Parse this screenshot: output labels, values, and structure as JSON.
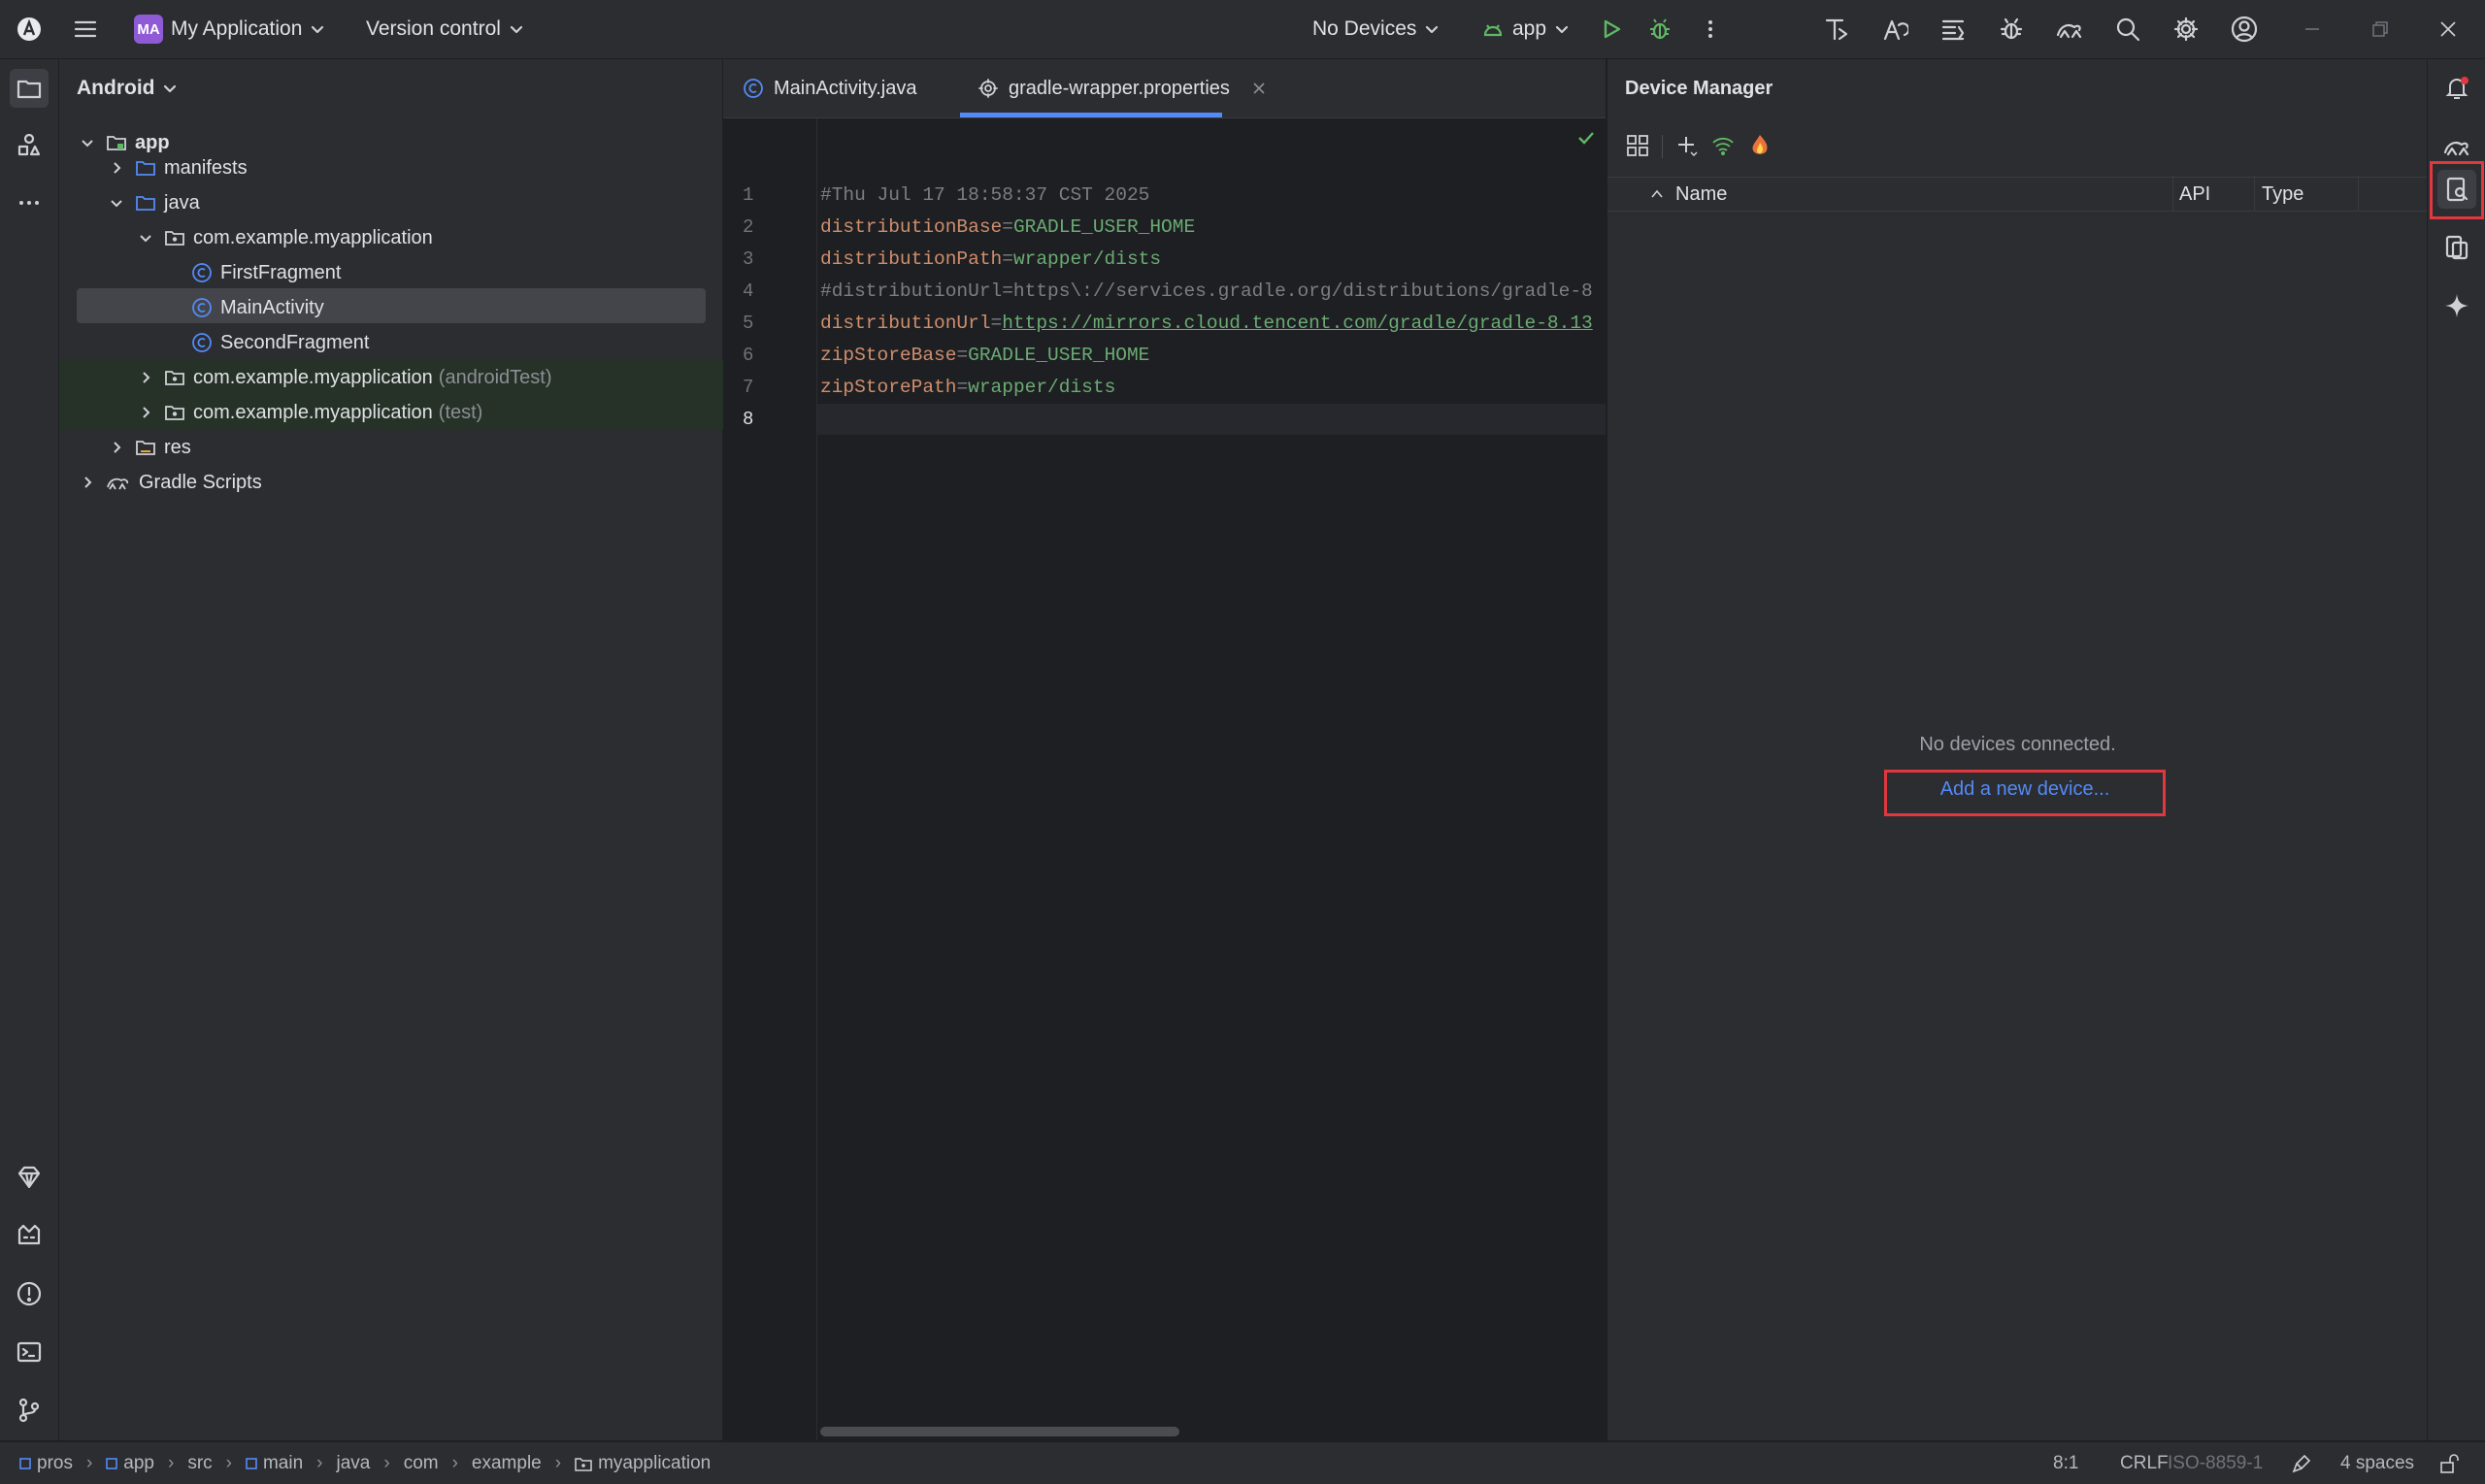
{
  "titlebar": {
    "project_badge": "MA",
    "project_name": "My Application",
    "vcs": "Version control",
    "devices": "No Devices",
    "run_config": "app"
  },
  "project_panel": {
    "view_mode": "Android",
    "tree": [
      {
        "label": "app",
        "suffix": ""
      },
      {
        "label": "manifests",
        "suffix": ""
      },
      {
        "label": "java",
        "suffix": ""
      },
      {
        "label": "com.example.myapplication",
        "suffix": ""
      },
      {
        "label": "FirstFragment",
        "suffix": ""
      },
      {
        "label": "MainActivity",
        "suffix": ""
      },
      {
        "label": "SecondFragment",
        "suffix": ""
      },
      {
        "label": "com.example.myapplication",
        "suffix": "(androidTest)"
      },
      {
        "label": "com.example.myapplication",
        "suffix": "(test)"
      },
      {
        "label": "res",
        "suffix": ""
      },
      {
        "label": "Gradle Scripts",
        "suffix": ""
      }
    ]
  },
  "editor": {
    "tabs": [
      {
        "label": "MainActivity.java"
      },
      {
        "label": "gradle-wrapper.properties"
      }
    ],
    "line_numbers": [
      "1",
      "2",
      "3",
      "4",
      "5",
      "6",
      "7",
      "8"
    ],
    "lines": [
      {
        "key": "#Thu Jul 17 18:58:37 CST 2025",
        "eq": "",
        "val": ""
      },
      {
        "key": "distributionBase",
        "eq": "=",
        "val": "GRADLE_USER_HOME"
      },
      {
        "key": "distributionPath",
        "eq": "=",
        "val": "wrapper/dists"
      },
      {
        "key": "#distributionUrl=https\\://services.gradle.org/distributions/gradle-8",
        "eq": "",
        "val": ""
      },
      {
        "key": "distributionUrl",
        "eq": "=",
        "val": "https://mirrors.cloud.tencent.com/gradle/gradle-8.13"
      },
      {
        "key": "zipStoreBase",
        "eq": "=",
        "val": "GRADLE_USER_HOME"
      },
      {
        "key": "zipStorePath",
        "eq": "=",
        "val": "wrapper/dists"
      },
      {
        "key": "",
        "eq": "",
        "val": ""
      }
    ]
  },
  "device_manager": {
    "title": "Device Manager",
    "columns": {
      "name": "Name",
      "api": "API",
      "type": "Type"
    },
    "empty_text": "No devices connected.",
    "add_link": "Add a new device..."
  },
  "statusbar": {
    "breadcrumbs": [
      "pros",
      "app",
      "src",
      "main",
      "java",
      "com",
      "example",
      "myapplication"
    ],
    "position": "8:1",
    "line_sep": "CRLF",
    "encoding": "ISO-8859-1",
    "indent": "4 spaces"
  },
  "colors": {
    "accent_blue": "#548af7",
    "highlight_red": "#e0383e",
    "run_green": "#5fb865"
  }
}
